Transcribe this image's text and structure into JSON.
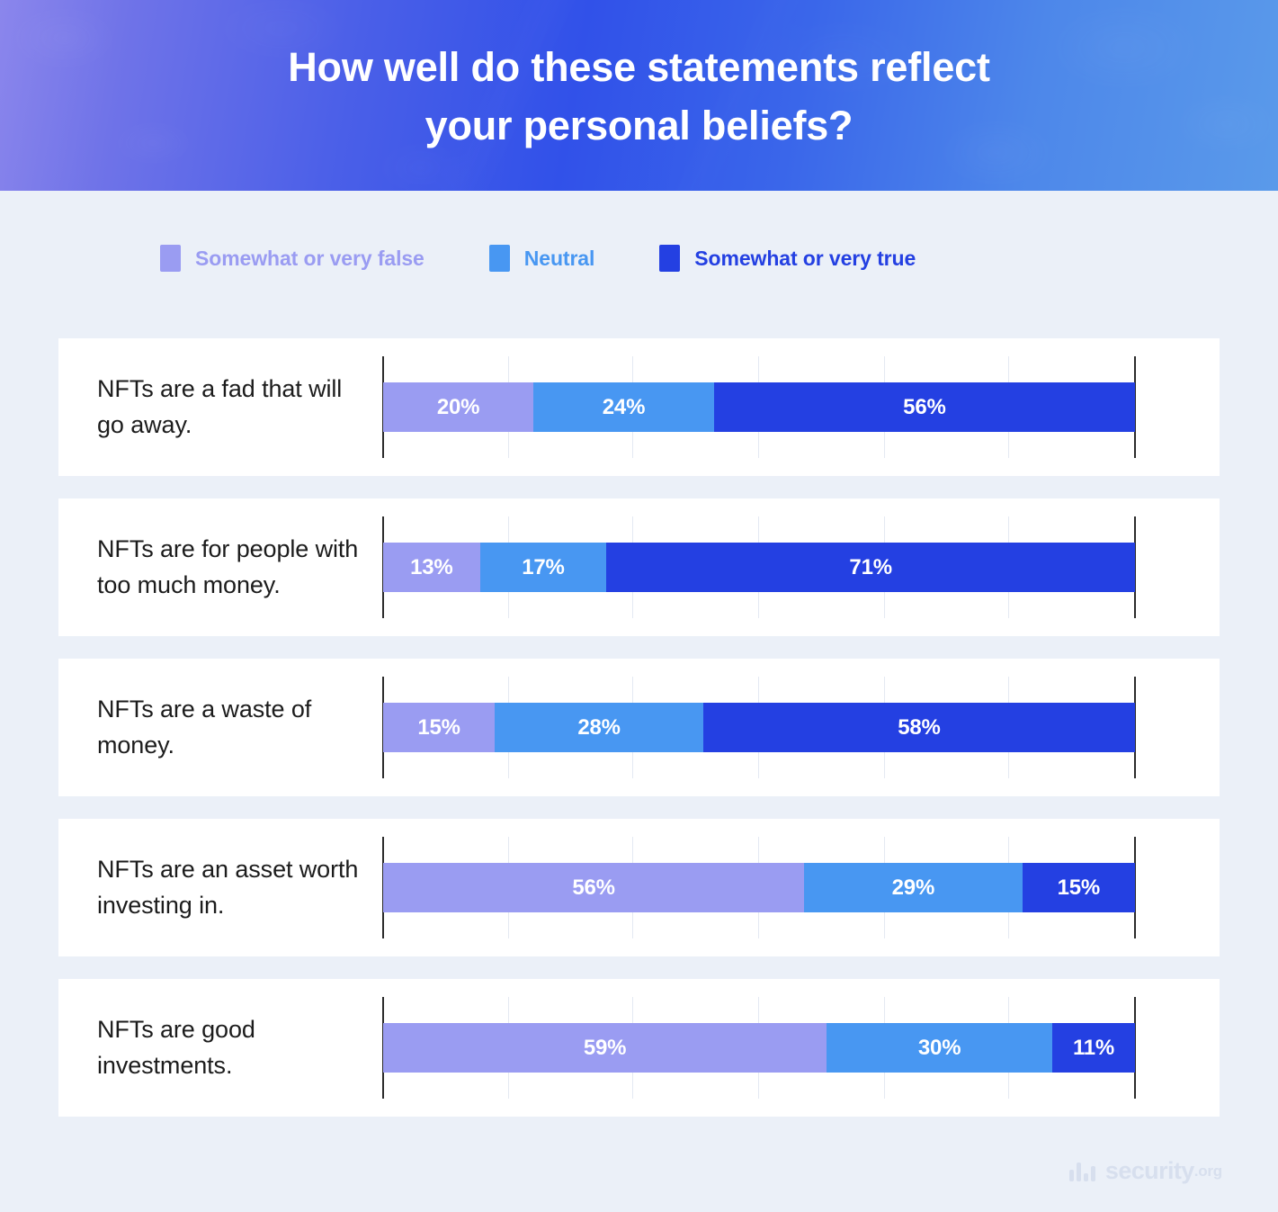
{
  "header": {
    "title_line1": "How well do these statements reflect",
    "title_line2": "your personal beliefs?"
  },
  "legend": {
    "items": [
      {
        "label": "Somewhat or very false",
        "color": "#9a9cf2"
      },
      {
        "label": "Neutral",
        "color": "#4897f2"
      },
      {
        "label": "Somewhat or very true",
        "color": "#2440e2"
      }
    ]
  },
  "colors": {
    "background": "#ebf0f8",
    "card": "#ffffff",
    "false": "#9a9cf2",
    "neutral": "#4897f2",
    "true": "#2440e2",
    "axis": "#2b2b2b",
    "gridline": "#e4e9f2",
    "label_text": "#1c1c1c",
    "logo": "#d7dfee"
  },
  "footer": {
    "logo_name": "security",
    "logo_tld": ".org"
  },
  "chart_data": {
    "type": "bar",
    "orientation": "horizontal",
    "stacked": true,
    "stacked_percent": true,
    "title": "How well do these statements reflect your personal beliefs?",
    "xlabel": "",
    "ylabel": "",
    "xlim": [
      0,
      100
    ],
    "grid": true,
    "gridlines_at": [
      16.7,
      33.3,
      50,
      66.7,
      83.3
    ],
    "legend_position": "top-left",
    "categories": [
      "NFTs are a fad that will go away.",
      "NFTs are for people with too much money.",
      "NFTs are a waste of money.",
      "NFTs are an asset worth investing in.",
      "NFTs are good investments."
    ],
    "series": [
      {
        "name": "Somewhat or very false",
        "color": "#9a9cf2",
        "values": [
          20,
          13,
          15,
          56,
          59
        ]
      },
      {
        "name": "Neutral",
        "color": "#4897f2",
        "values": [
          24,
          17,
          28,
          29,
          30
        ]
      },
      {
        "name": "Somewhat or very true",
        "color": "#2440e2",
        "values": [
          56,
          71,
          58,
          15,
          11
        ]
      }
    ],
    "value_labels": [
      [
        "20%",
        "24%",
        "56%"
      ],
      [
        "13%",
        "17%",
        "71%"
      ],
      [
        "15%",
        "28%",
        "58%"
      ],
      [
        "56%",
        "29%",
        "15%"
      ],
      [
        "59%",
        "30%",
        "11%"
      ]
    ]
  }
}
